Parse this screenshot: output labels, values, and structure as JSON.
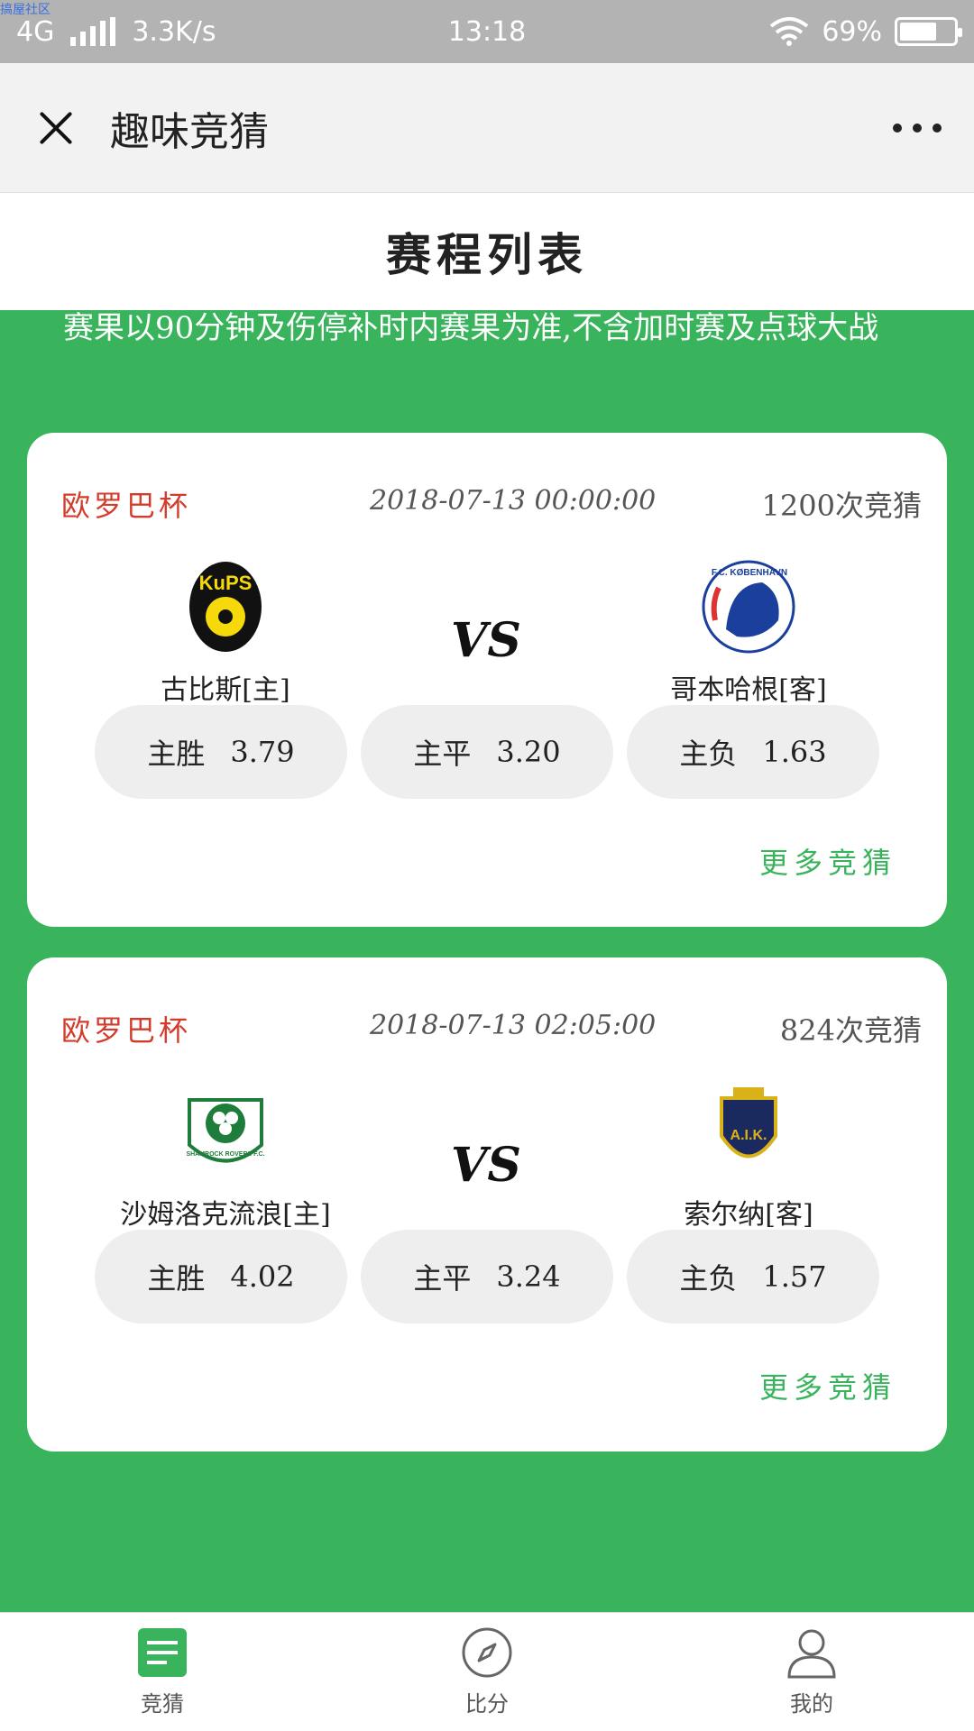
{
  "status_bar": {
    "watermark": "搞屋社区",
    "network": "4G",
    "speed": "3.3K/s",
    "time": "13:18",
    "battery": "69%"
  },
  "title_bar": {
    "title": "趣味竞猜",
    "icons": [
      "close-icon",
      "more-icon"
    ]
  },
  "page": {
    "heading": "赛程列表",
    "notice": "赛果以90分钟及伤停补时内赛果为准,不含加时赛及点球大战"
  },
  "matches": [
    {
      "league": "欧罗巴杯",
      "time": "2018-07-13 00:00:00",
      "count": "1200次竞猜",
      "home_team": "古比斯[主]",
      "away_team": "哥本哈根[客]",
      "home_logo": "kups-logo",
      "away_logo": "fc-kobenhavn-logo",
      "home_logo_text": "KuPS",
      "away_logo_text": "F.C. KØBENHAVN",
      "vs": "VS",
      "odds": [
        {
          "label": "主胜",
          "value": "3.79"
        },
        {
          "label": "主平",
          "value": "3.20"
        },
        {
          "label": "主负",
          "value": "1.63"
        }
      ],
      "more": "更多竞猜"
    },
    {
      "league": "欧罗巴杯",
      "time": "2018-07-13 02:05:00",
      "count": "824次竞猜",
      "home_team": "沙姆洛克流浪[主]",
      "away_team": "索尔纳[客]",
      "home_logo": "shamrock-rovers-logo",
      "away_logo": "aik-logo",
      "home_logo_text": "SHAMROCK ROVERS F.C.",
      "away_logo_text": "A.I.K.",
      "vs": "VS",
      "odds": [
        {
          "label": "主胜",
          "value": "4.02"
        },
        {
          "label": "主平",
          "value": "3.24"
        },
        {
          "label": "主负",
          "value": "1.57"
        }
      ],
      "more": "更多竞猜"
    }
  ],
  "bottom_nav": [
    {
      "label": "竞猜",
      "icon": "list-icon",
      "active": true
    },
    {
      "label": "比分",
      "icon": "compass-icon",
      "active": false
    },
    {
      "label": "我的",
      "icon": "user-icon",
      "active": false
    }
  ],
  "colors": {
    "accent": "#3ab45c",
    "league": "#d43b2b"
  }
}
